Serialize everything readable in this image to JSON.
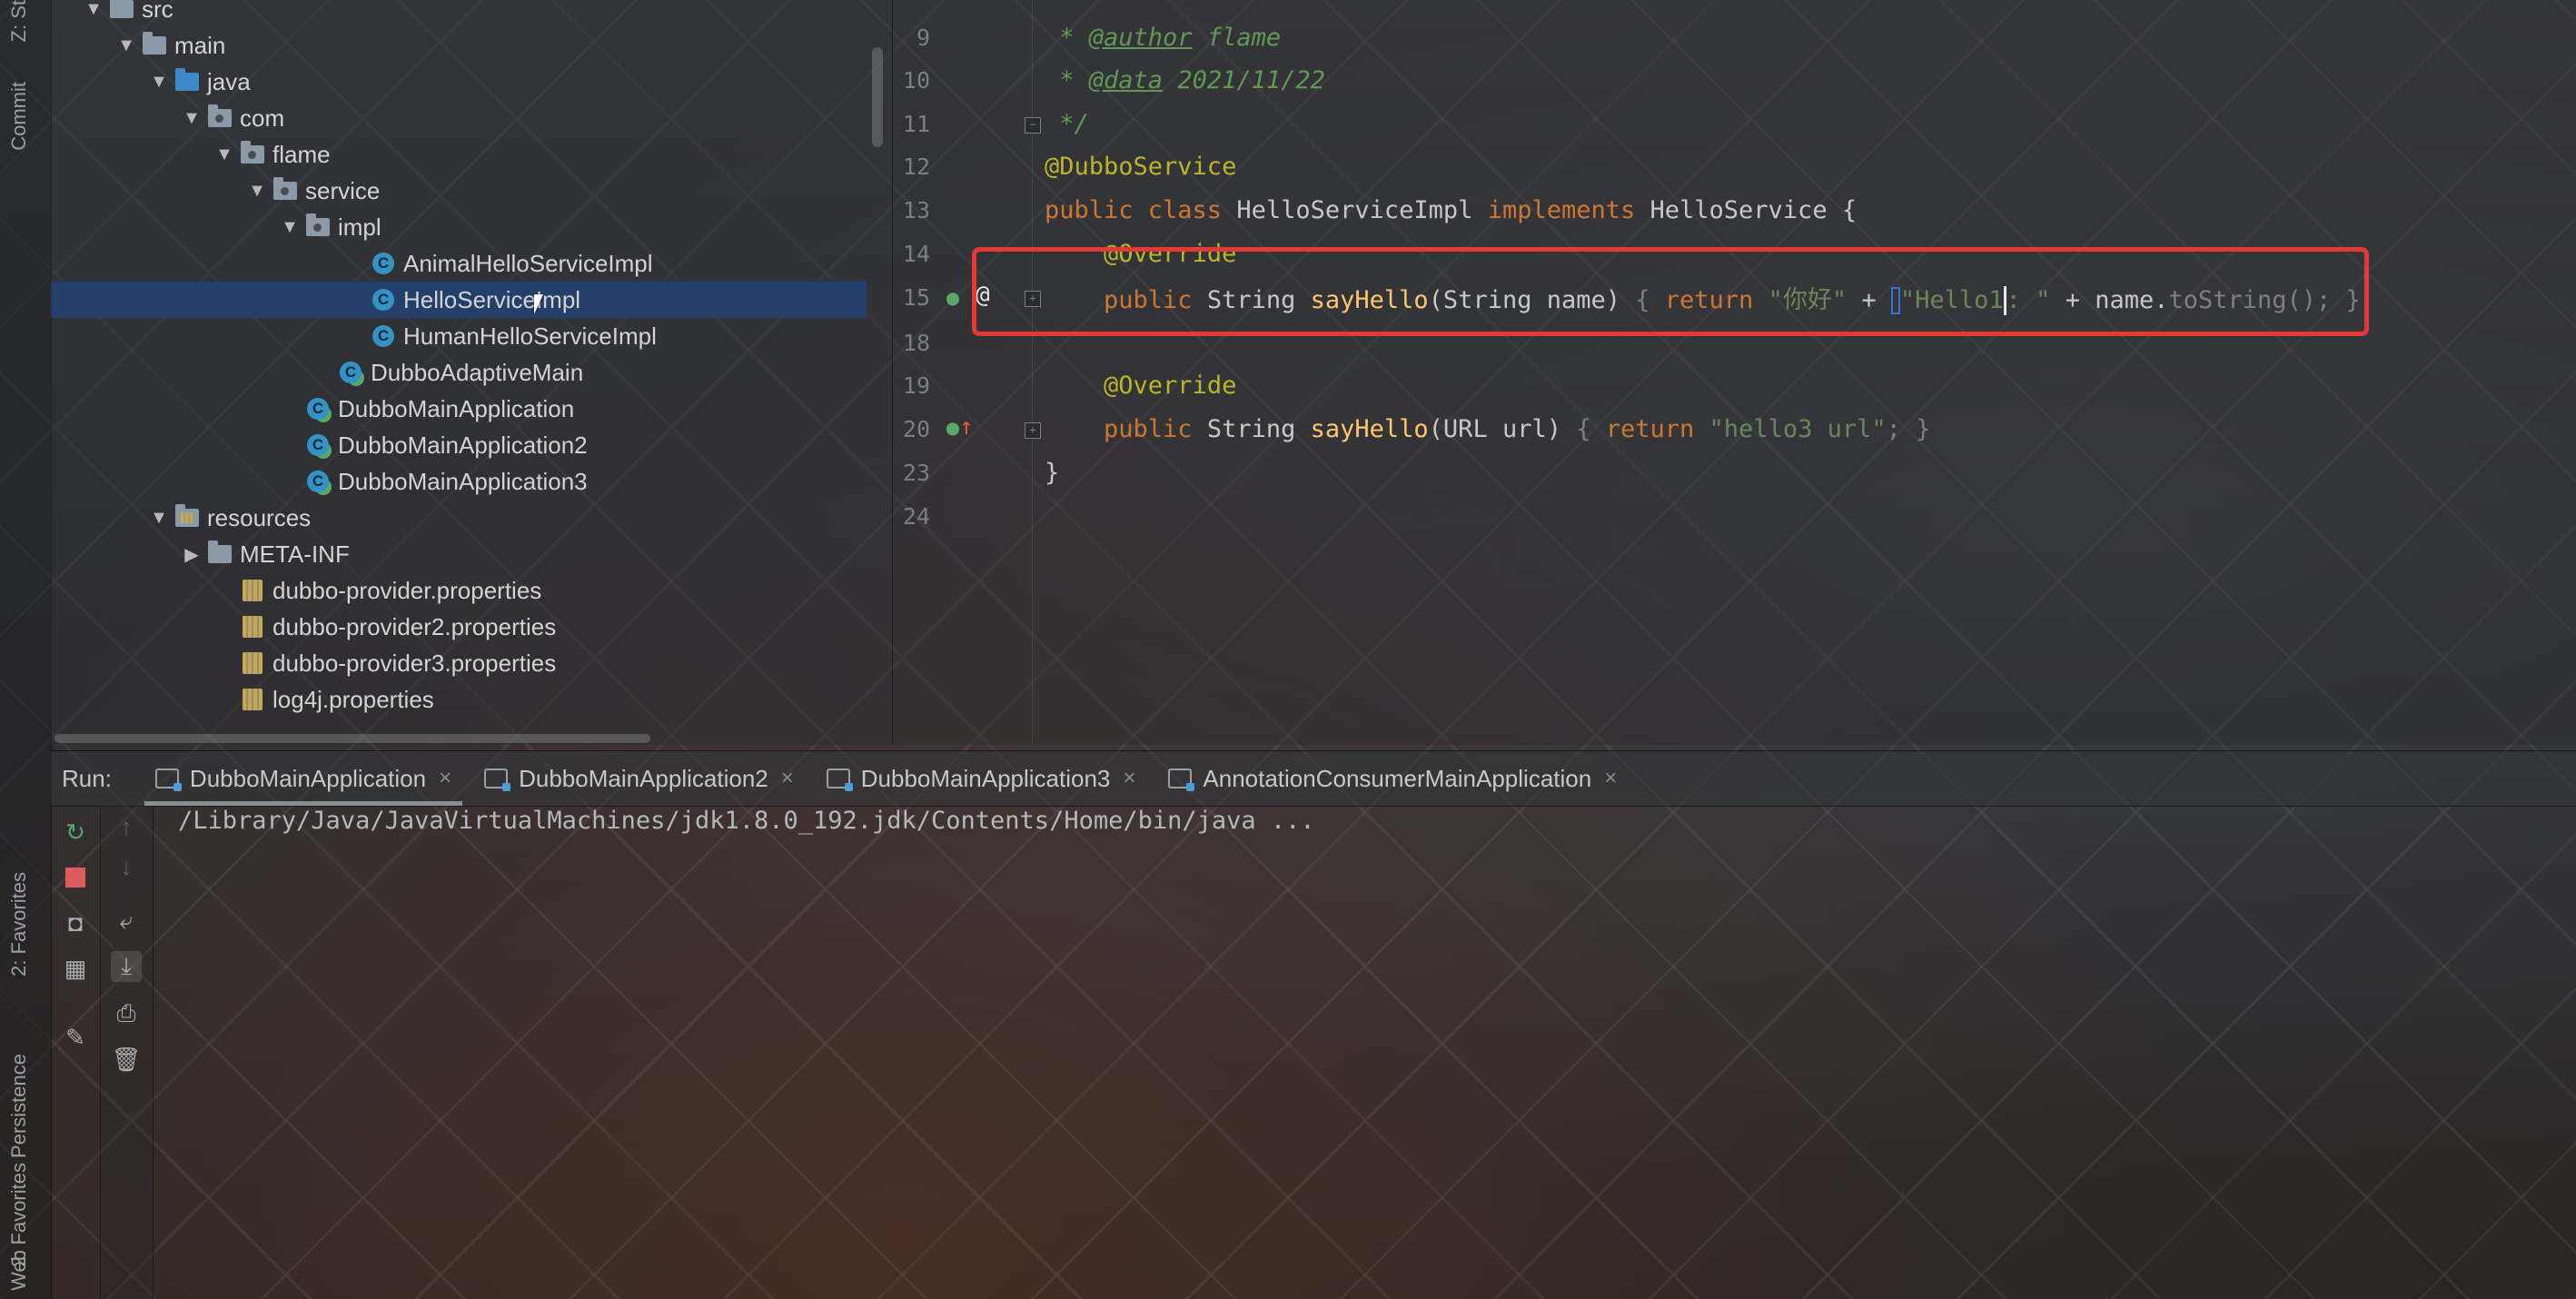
{
  "side_strip": {
    "top_label": "Z: St",
    "commit_label": "Commit",
    "favorites_label": "2: Favorites",
    "persistence_label": "Persistence",
    "favorites2_label": "2: Favorites",
    "web_label": "Web"
  },
  "project_tree": [
    {
      "label": "src",
      "depth": 2,
      "icon": "folder",
      "expanded": true
    },
    {
      "label": "main",
      "depth": 3,
      "icon": "folder",
      "expanded": true
    },
    {
      "label": "java",
      "depth": 4,
      "icon": "source-folder",
      "expanded": true
    },
    {
      "label": "com",
      "depth": 5,
      "icon": "package",
      "expanded": true
    },
    {
      "label": "flame",
      "depth": 6,
      "icon": "package",
      "expanded": true
    },
    {
      "label": "service",
      "depth": 7,
      "icon": "package",
      "expanded": true
    },
    {
      "label": "impl",
      "depth": 8,
      "icon": "package",
      "expanded": true
    },
    {
      "label": "AnimalHelloServiceImpl",
      "depth": 10,
      "icon": "class"
    },
    {
      "label": "HelloServiceImpl",
      "depth": 10,
      "icon": "class",
      "selected": true
    },
    {
      "label": "HumanHelloServiceImpl",
      "depth": 10,
      "icon": "class"
    },
    {
      "label": "DubboAdaptiveMain",
      "depth": 9,
      "icon": "class-run"
    },
    {
      "label": "DubboMainApplication",
      "depth": 8,
      "icon": "class-run"
    },
    {
      "label": "DubboMainApplication2",
      "depth": 8,
      "icon": "class-run"
    },
    {
      "label": "DubboMainApplication3",
      "depth": 8,
      "icon": "class-run"
    },
    {
      "label": "resources",
      "depth": 4,
      "icon": "resources-folder",
      "expanded": true
    },
    {
      "label": "META-INF",
      "depth": 5,
      "icon": "folder",
      "expanded": false
    },
    {
      "label": "dubbo-provider.properties",
      "depth": 6,
      "icon": "properties"
    },
    {
      "label": "dubbo-provider2.properties",
      "depth": 6,
      "icon": "properties"
    },
    {
      "label": "dubbo-provider3.properties",
      "depth": 6,
      "icon": "properties"
    },
    {
      "label": "log4j.properties",
      "depth": 6,
      "icon": "properties"
    }
  ],
  "editor": {
    "lines": [
      {
        "num": "9",
        "kind": "doc",
        "text_prefix": " * ",
        "tag": "@author",
        "text_suffix": " flame"
      },
      {
        "num": "10",
        "kind": "doc",
        "text_prefix": " * ",
        "tag": "@data",
        "text_suffix": " 2021/11/22"
      },
      {
        "num": "11",
        "kind": "doc-end",
        "text": " */"
      },
      {
        "num": "12",
        "kind": "annotation",
        "text": "@DubboService"
      },
      {
        "num": "13",
        "kind": "class-decl",
        "kw1": "public class",
        "name": " HelloServiceImpl ",
        "kw2": "implements",
        "iface": " HelloService {"
      },
      {
        "num": "14",
        "kind": "annotation-indent",
        "text": "@Override"
      },
      {
        "num": "15",
        "kind": "method1",
        "kw": "public",
        "type": " String ",
        "fn": "sayHello",
        "params": "(String name) ",
        "brace_open": "{ ",
        "ret": "return ",
        "str1": "\"你好\"",
        "plus1": " + ",
        "str2a": "\"Hello1",
        "str2b": ": \"",
        "plus2": " + name.",
        "call": "toString(); }"
      },
      {
        "num": "18",
        "kind": "blank"
      },
      {
        "num": "19",
        "kind": "annotation-indent",
        "text": "@Override"
      },
      {
        "num": "20",
        "kind": "method2",
        "kw": "public",
        "type": " String ",
        "fn": "sayHello",
        "params": "(URL url) ",
        "brace_open": "{ ",
        "ret": "return ",
        "str": "\"hello3 url\"",
        "tail": "; }"
      },
      {
        "num": "23",
        "kind": "close",
        "text": "}"
      },
      {
        "num": "24",
        "kind": "blank"
      }
    ]
  },
  "run_panel": {
    "label": "Run:",
    "tabs": [
      {
        "label": "DubboMainApplication",
        "active": true
      },
      {
        "label": "DubboMainApplication2",
        "active": false
      },
      {
        "label": "DubboMainApplication3",
        "active": false
      },
      {
        "label": "AnnotationConsumerMainApplication",
        "active": false
      }
    ],
    "console_line": "/Library/Java/JavaVirtualMachines/jdk1.8.0_192.jdk/Contents/Home/bin/java ..."
  },
  "colors": {
    "keyword": "#cc7832",
    "annotation": "#bbb529",
    "string": "#6a8759",
    "function": "#ffc66d",
    "highlight_box": "#e53935",
    "selection": "#214273"
  }
}
